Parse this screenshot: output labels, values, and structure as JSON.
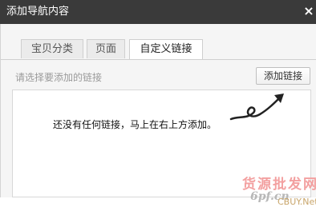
{
  "dialog": {
    "title": "添加导航内容",
    "close_glyph": "×"
  },
  "tabs": [
    {
      "label": "宝贝分类",
      "active": false
    },
    {
      "label": "页面",
      "active": false
    },
    {
      "label": "自定义链接",
      "active": true
    }
  ],
  "toolbar": {
    "hint": "请选择要添加的链接",
    "add_link_label": "添加链接"
  },
  "content": {
    "empty_message": "还没有任何链接，马上在右上方添加。",
    "arrow_icon": "curly-arrow-icon"
  },
  "watermark": {
    "line1": "货源批发网",
    "line2": "6pf.cn",
    "line3": "CBUY.Net"
  }
}
